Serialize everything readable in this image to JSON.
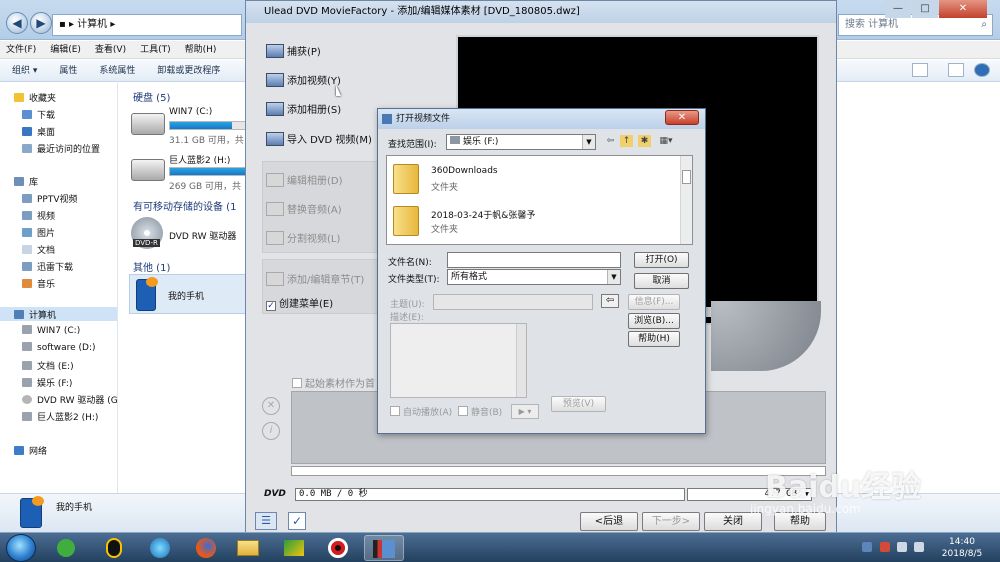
{
  "explorer": {
    "address": "计算机",
    "search_placeholder": "搜索 计算机",
    "menu": [
      "文件(F)",
      "编辑(E)",
      "查看(V)",
      "工具(T)",
      "帮助(H)"
    ],
    "toolbar": [
      "组织 ▾",
      "属性",
      "系统属性",
      "卸载或更改程序"
    ],
    "nav": {
      "favorites_label": "收藏夹",
      "favorites": [
        "下载",
        "桌面",
        "最近访问的位置"
      ],
      "libraries_label": "库",
      "libraries": [
        "PPTV视频",
        "视频",
        "图片",
        "文档",
        "迅雷下载",
        "音乐"
      ],
      "computer_label": "计算机",
      "computer": [
        "WIN7 (C:)",
        "software (D:)",
        "文档 (E:)",
        "娱乐 (F:)",
        "DVD RW 驱动器 (G",
        "巨人蓝影2 (H:)"
      ],
      "network_label": "网络"
    },
    "groups": {
      "hdd": "硬盘 (5)",
      "removable": "有可移动存储的设备 (1",
      "other": "其他 (1)"
    },
    "drives": [
      {
        "name": "WIN7 (C:)",
        "free": "31.1 GB 可用，共",
        "used_pct": 70
      },
      {
        "name": "巨人蓝影2 (H:)",
        "free": "269 GB 可用，共",
        "used_pct": 90
      }
    ],
    "dvd_drive": "DVD RW 驱动器",
    "dvd_badge": "DVD-R",
    "phone": "我的手机",
    "status_item": "我的手机"
  },
  "ulead": {
    "title": "Ulead DVD MovieFactory - 添加/编辑媒体素材    [DVD_180805.dwz]",
    "actions": [
      "捕获(P)",
      "添加视频(Y)",
      "添加相册(S)",
      "导入 DVD 视频(M)"
    ],
    "disabled_actions": [
      "编辑相册(D)",
      "替换音频(A)",
      "分割视频(L)"
    ],
    "chapter_action": "添加/编辑章节(T)",
    "create_menu_label": "创建菜单(E)",
    "start_media_label": "起始素材作为首",
    "dvd_label": "DVD",
    "dvd_size": "0.0 MB / 0 秒",
    "dvd_capacity": "4.7 GB",
    "buttons": {
      "back": "<后退",
      "next": "下一步>",
      "close": "关闭",
      "help": "帮助"
    }
  },
  "dialog": {
    "title": "打开视频文件",
    "lookin_label": "查找范围(I):",
    "lookin_value": "娱乐 (F:)",
    "files": [
      {
        "name": "360Downloads",
        "type": "文件夹"
      },
      {
        "name": "2018-03-24于帆&张馨予",
        "type": "文件夹"
      }
    ],
    "filename_label": "文件名(N):",
    "filename_value": "",
    "filetype_label": "文件类型(T):",
    "filetype_value": "所有格式",
    "subject_label": "主题(U):",
    "desc_label": "描述(E):",
    "autoplay_label": "自动播放(A)",
    "mute_label": "静音(B)",
    "preview_label": "预览(V)",
    "buttons": {
      "open": "打开(O)",
      "cancel": "取消",
      "info": "信息(F)...",
      "browse": "浏览(B)...",
      "help": "帮助(H)"
    }
  },
  "taskbar": {
    "time": "14:40",
    "date": "2018/8/5"
  },
  "watermark": {
    "brand": "Baidu经验",
    "url": "jingyan.baidu.com"
  }
}
